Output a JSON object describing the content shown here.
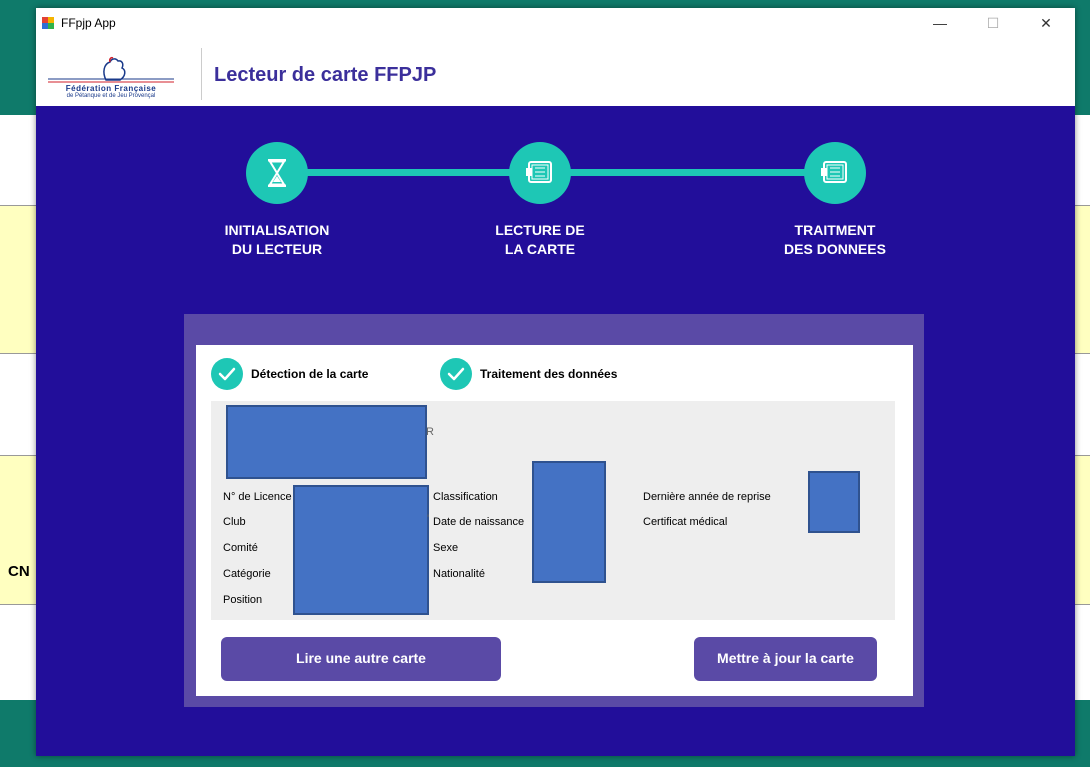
{
  "window": {
    "title": "FFpjp App",
    "min_symbol": "—",
    "max_symbol": "☐",
    "close_symbol": "✕"
  },
  "header": {
    "logo_line1": "Fédération Française",
    "logo_line2": "de Pétanque et de Jeu Provençal",
    "title": "Lecteur de carte FFPJP"
  },
  "background": {
    "cn_text": "CN"
  },
  "steps": [
    {
      "line1": "INITIALISATION",
      "line2": "DU LECTEUR",
      "icon": "hourglass-icon"
    },
    {
      "line1": "LECTURE DE",
      "line2": "LA CARTE",
      "icon": "card-icon"
    },
    {
      "line1": "TRAITMENT",
      "line2": "DES DONNEES",
      "icon": "card-icon"
    }
  ],
  "statuses": [
    {
      "label": "Détection de la carte",
      "checked": true
    },
    {
      "label": "Traitement des données",
      "checked": true
    }
  ],
  "card_info": {
    "stray_char": "R",
    "stray_tick": "'",
    "col1_labels": [
      "N° de Licence",
      "Club",
      "Comité",
      "Catégorie",
      "Position"
    ],
    "col2_labels": [
      "Classification",
      "Date de naissance",
      "Sexe",
      "Nationalité"
    ],
    "col3_labels": [
      "Dernière année de reprise",
      "Certificat médical"
    ]
  },
  "buttons": {
    "read_another": "Lire une autre carte",
    "update_card": "Mettre à jour la carte"
  },
  "colors": {
    "main_bg": "#220e9a",
    "accent_teal": "#1ec7b5",
    "panel_purple": "#5a4aa6",
    "redaction_blue": "#4472c4"
  }
}
